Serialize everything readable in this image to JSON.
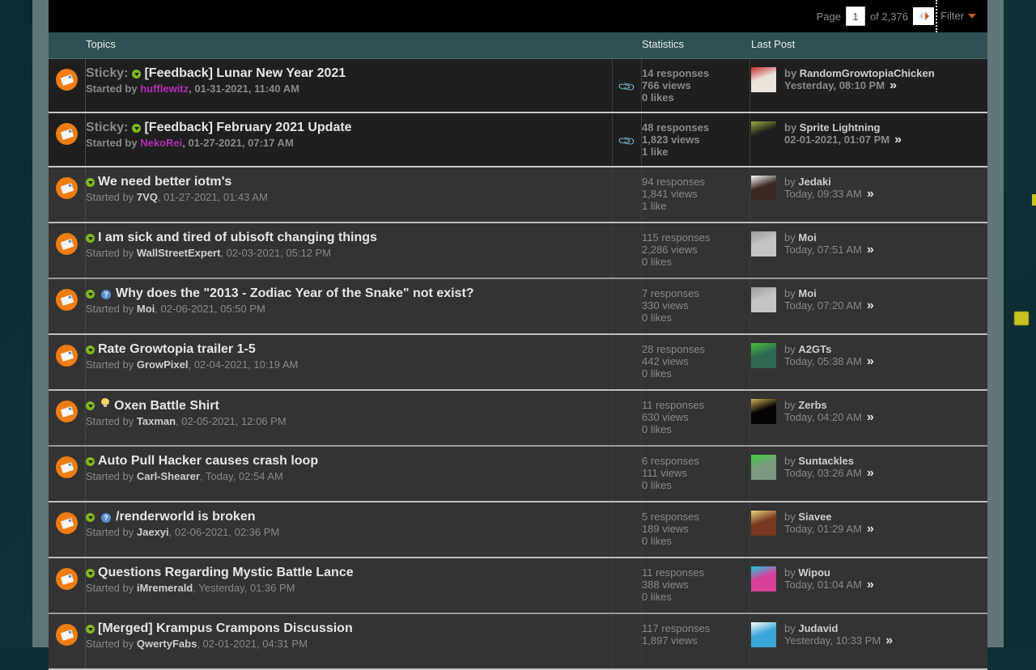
{
  "pager": {
    "label": "Page",
    "current": "1",
    "of_label": "of 2,376",
    "filter_label": "Filter"
  },
  "columns": {
    "topics": "Topics",
    "statistics": "Statistics",
    "last_post": "Last Post"
  },
  "colors": {
    "accent_orange": "#f07d12",
    "status_green": "#7fbb1c",
    "moderator_purple": "#b42db5",
    "header_teal": "#2f5152"
  },
  "threads": [
    {
      "sticky": true,
      "sticky_label": "Sticky:",
      "prefix_icon": "",
      "title": "[Feedback] Lunar New Year 2021",
      "started_by": "Started by",
      "author": "hufflewitz",
      "author_mod": true,
      "date": ", 01-31-2021, 11:40 AM",
      "attachment": true,
      "responses": "14 responses",
      "views": "766 views",
      "likes": "0 likes",
      "lp_by": "by",
      "lp_author": "RandomGrowtopiaChicken",
      "lp_date": "Yesterday, 08:10 PM",
      "avatar_color": "#e9e4da",
      "avatar_accent": "#c52b2b"
    },
    {
      "sticky": true,
      "sticky_label": "Sticky:",
      "prefix_icon": "",
      "title": "[Feedback] February 2021 Update",
      "started_by": "Started by",
      "author": "NekoRei",
      "author_mod": true,
      "date": ", 01-27-2021, 07:17 AM",
      "attachment": true,
      "responses": "48 responses",
      "views": "1,823 views",
      "likes": "1 like",
      "lp_by": "by",
      "lp_author": "Sprite Lightning",
      "lp_date": "02-01-2021, 01:07 PM",
      "avatar_color": "#1f1f1f",
      "avatar_accent": "#9aab3a"
    },
    {
      "sticky": false,
      "sticky_label": "",
      "prefix_icon": "",
      "title": "We need better iotm's",
      "started_by": "Started by",
      "author": "7VQ",
      "author_mod": false,
      "date": ", 01-27-2021, 01:43 AM",
      "attachment": false,
      "responses": "94 responses",
      "views": "1,841 views",
      "likes": "1 like",
      "lp_by": "by",
      "lp_author": "Jedaki",
      "lp_date": "Today, 09:33 AM",
      "avatar_color": "#3a2a22",
      "avatar_accent": "#ffffff"
    },
    {
      "sticky": false,
      "sticky_label": "",
      "prefix_icon": "",
      "title": "I am sick and tired of ubisoft changing things",
      "started_by": "Started by",
      "author": "WallStreetExpert",
      "author_mod": false,
      "date": ", 02-03-2021, 05:12 PM",
      "attachment": false,
      "responses": "115 responses",
      "views": "2,286 views",
      "likes": "0 likes",
      "lp_by": "by",
      "lp_author": "Moi",
      "lp_date": "Today, 07:51 AM",
      "avatar_color": "#c4c4c4",
      "avatar_accent": "#9a9a9a"
    },
    {
      "sticky": false,
      "sticky_label": "",
      "prefix_icon": "question",
      "title": "Why does the \"2013 - Zodiac Year of the Snake\" not exist?",
      "started_by": "Started by",
      "author": "Moi",
      "author_mod": false,
      "date": ", 02-06-2021, 05:50 PM",
      "attachment": false,
      "responses": "7 responses",
      "views": "330 views",
      "likes": "0 likes",
      "lp_by": "by",
      "lp_author": "Moi",
      "lp_date": "Today, 07:20 AM",
      "avatar_color": "#c4c4c4",
      "avatar_accent": "#9a9a9a"
    },
    {
      "sticky": false,
      "sticky_label": "",
      "prefix_icon": "",
      "title": "Rate Growtopia trailer 1-5",
      "started_by": "Started by",
      "author": "GrowPixel",
      "author_mod": false,
      "date": ", 02-04-2021, 10:19 AM",
      "attachment": false,
      "responses": "28 responses",
      "views": "442 views",
      "likes": "0 likes",
      "lp_by": "by",
      "lp_author": "A2GTs",
      "lp_date": "Today, 05:38 AM",
      "avatar_color": "#2f6a50",
      "avatar_accent": "#48c23a"
    },
    {
      "sticky": false,
      "sticky_label": "",
      "prefix_icon": "idea",
      "title": "Oxen Battle Shirt",
      "started_by": "Started by",
      "author": "Taxman",
      "author_mod": false,
      "date": ", 02-05-2021, 12:06 PM",
      "attachment": false,
      "responses": "11 responses",
      "views": "630 views",
      "likes": "0 likes",
      "lp_by": "by",
      "lp_author": "Zerbs",
      "lp_date": "Today, 04:20 AM",
      "avatar_color": "#050505",
      "avatar_accent": "#d4b455"
    },
    {
      "sticky": false,
      "sticky_label": "",
      "prefix_icon": "",
      "title": "Auto Pull Hacker causes crash loop",
      "started_by": "Started by",
      "author": "Carl-Shearer",
      "author_mod": false,
      "date": ", Today, 02:54 AM",
      "attachment": false,
      "responses": "6 responses",
      "views": "111 views",
      "likes": "0 likes",
      "lp_by": "by",
      "lp_author": "Suntackles",
      "lp_date": "Today, 03:26 AM",
      "avatar_color": "#7a9a80",
      "avatar_accent": "#3fd13a"
    },
    {
      "sticky": false,
      "sticky_label": "",
      "prefix_icon": "question",
      "title": "/renderworld is broken",
      "started_by": "Started by",
      "author": "Jaexyi",
      "author_mod": false,
      "date": ", 02-06-2021, 02:36 PM",
      "attachment": false,
      "responses": "5 responses",
      "views": "189 views",
      "likes": "0 likes",
      "lp_by": "by",
      "lp_author": "Siavee",
      "lp_date": "Today, 01:29 AM",
      "avatar_color": "#7a3a22",
      "avatar_accent": "#e8d27a"
    },
    {
      "sticky": false,
      "sticky_label": "",
      "prefix_icon": "",
      "title": "Questions Regarding Mystic Battle Lance",
      "started_by": "Started by",
      "author": "iMremerald",
      "author_mod": false,
      "date": ", Yesterday, 01:36 PM",
      "attachment": false,
      "responses": "11 responses",
      "views": "388 views",
      "likes": "0 likes",
      "lp_by": "by",
      "lp_author": "Wipou",
      "lp_date": "Today, 01:04 AM",
      "avatar_color": "#d8409a",
      "avatar_accent": "#22c8e0"
    },
    {
      "sticky": false,
      "sticky_label": "",
      "prefix_icon": "",
      "title": "[Merged] Krampus Crampons Discussion",
      "started_by": "Started by",
      "author": "QwertyFabs",
      "author_mod": false,
      "date": ", 02-01-2021, 04:31 PM",
      "attachment": false,
      "responses": "117 responses",
      "views": "1,897 views",
      "likes": "",
      "lp_by": "by",
      "lp_author": "Judavid",
      "lp_date": "Yesterday, 10:33 PM",
      "avatar_color": "#3aa6d8",
      "avatar_accent": "#ffffff"
    }
  ]
}
